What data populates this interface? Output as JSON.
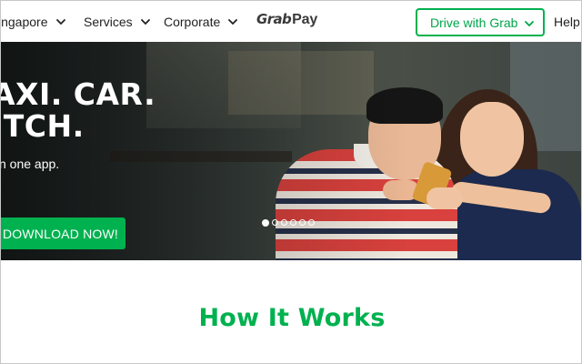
{
  "header": {
    "nav": [
      {
        "label": "ingapore",
        "icon": "chevron-down-icon"
      },
      {
        "label": "Services",
        "icon": "chevron-down-icon"
      },
      {
        "label": "Corporate",
        "icon": "chevron-down-icon"
      }
    ],
    "logo": {
      "part1": "Grab",
      "part2": "Pay"
    },
    "drive_button": {
      "label": "Drive with Grab",
      "icon": "chevron-down-icon"
    },
    "help_label": "Help"
  },
  "hero": {
    "title_line1": "AXI. CAR.",
    "title_line2": "ITCH.",
    "subtitle": "n one app.",
    "download_label": "DOWNLOAD NOW!",
    "carousel": {
      "count": 6,
      "active_index": 0
    }
  },
  "section": {
    "title": "How It Works"
  },
  "colors": {
    "accent": "#00b14f",
    "text": "#222222",
    "hero_text": "#ffffff"
  }
}
